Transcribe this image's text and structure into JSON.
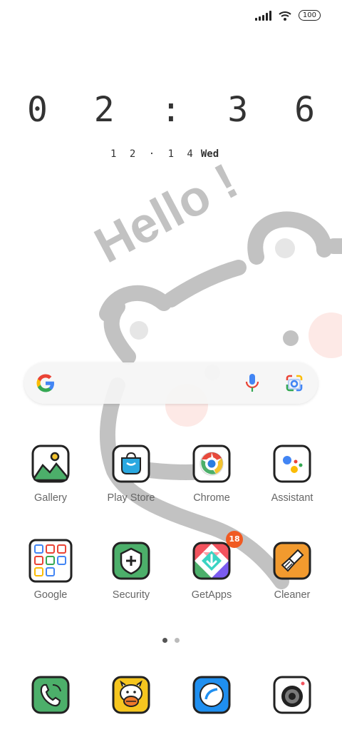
{
  "status_bar": {
    "battery": "100"
  },
  "clock": {
    "time": "0 2 : 3 6",
    "date": "1 2 · 1 4",
    "weekday": "Wed"
  },
  "wallpaper": {
    "text": "Hello !"
  },
  "search_bar": {
    "icons": [
      "google-logo-icon",
      "mic-icon",
      "google-lens-icon"
    ]
  },
  "apps_row1": [
    {
      "label": "Gallery",
      "icon": "gallery-icon"
    },
    {
      "label": "Play Store",
      "icon": "play-store-icon"
    },
    {
      "label": "Chrome",
      "icon": "chrome-icon"
    },
    {
      "label": "Assistant",
      "icon": "assistant-icon"
    }
  ],
  "apps_row2": [
    {
      "label": "Google",
      "icon": "google-folder-icon"
    },
    {
      "label": "Security",
      "icon": "security-icon"
    },
    {
      "label": "GetApps",
      "icon": "getapps-icon",
      "badge": "18"
    },
    {
      "label": "Cleaner",
      "icon": "cleaner-icon"
    }
  ],
  "dock": [
    {
      "icon": "phone-icon"
    },
    {
      "icon": "messages-icon"
    },
    {
      "icon": "browser-icon"
    },
    {
      "icon": "camera-icon"
    }
  ],
  "page_indicator": {
    "pages": 2,
    "current": 1
  },
  "colors": {
    "badge": "#f05a22",
    "wallpaper_stroke": "#c2c2c2",
    "wallpaper_blush": "#fde3e0"
  }
}
